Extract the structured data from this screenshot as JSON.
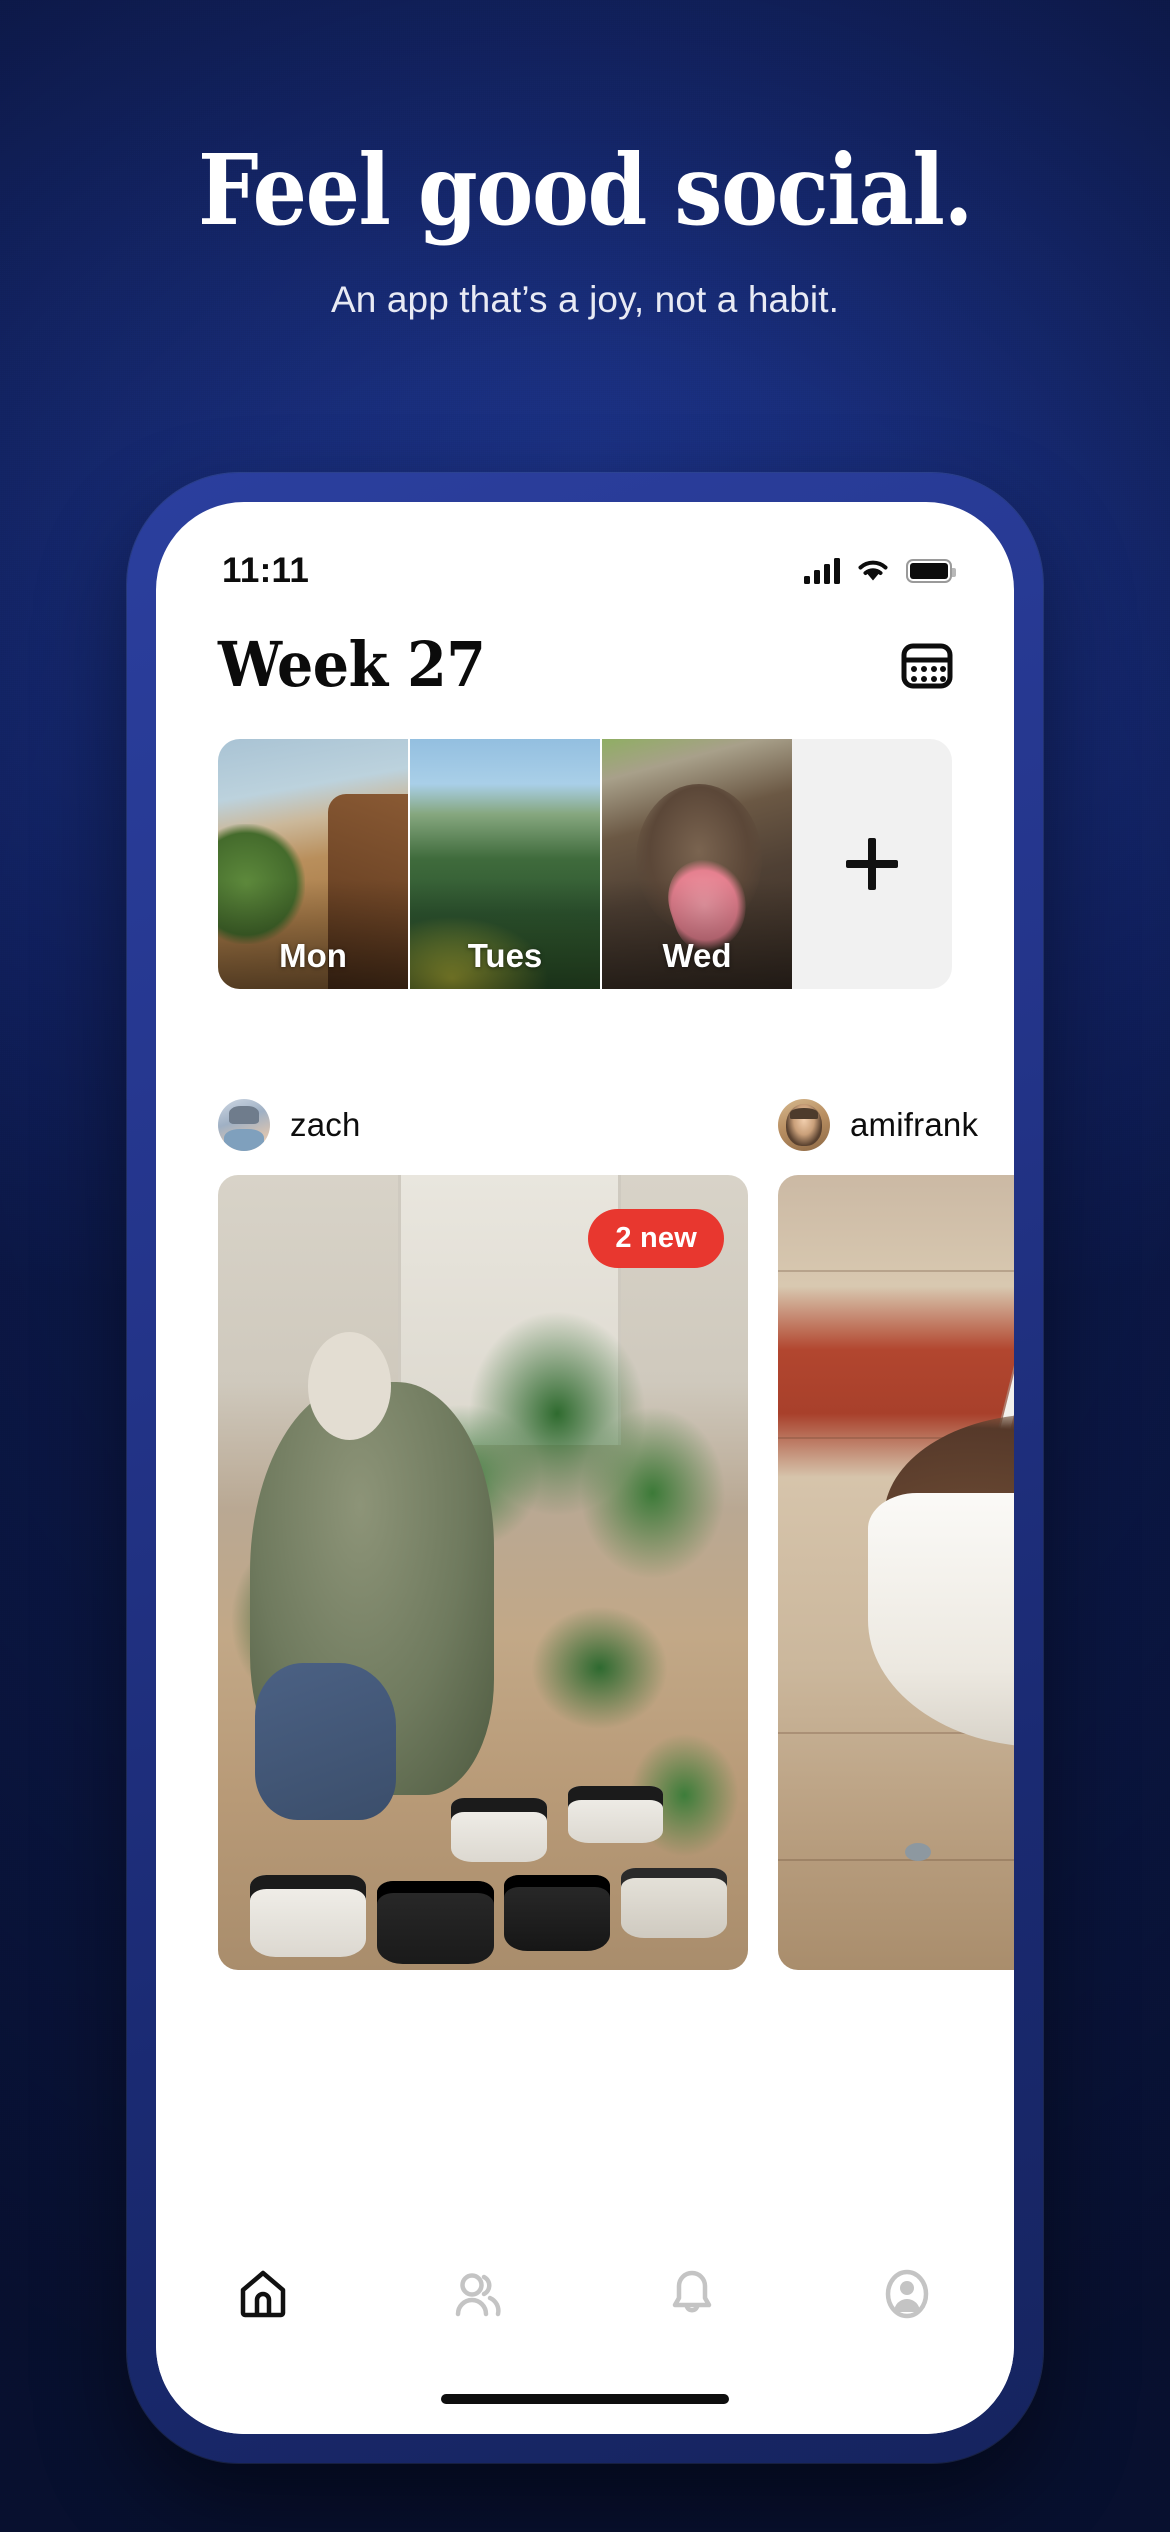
{
  "hero": {
    "headline": "Feel good social.",
    "subheadline": "An app that’s a joy, not a habit.",
    "background_color": "#15286f"
  },
  "phone": {
    "frame_color": "#24358b",
    "screen_background": "#ffffff"
  },
  "status_bar": {
    "time": "11:11",
    "icons": [
      "cellular-signal-icon",
      "wifi-icon",
      "battery-icon"
    ],
    "battery_full": true
  },
  "app_header": {
    "title": "Week 27",
    "calendar_button": "calendar-icon"
  },
  "day_strip": {
    "days": [
      {
        "label": "Mon",
        "photo": "window-desk-plant"
      },
      {
        "label": "Tues",
        "photo": "forest-hillside"
      },
      {
        "label": "Wed",
        "photo": "dog-licking-nose"
      }
    ],
    "add_button_label": "+",
    "add_button_background": "#f1f1f1"
  },
  "feed": {
    "posts": [
      {
        "username": "zach",
        "avatar": "zach-avatar",
        "photo": "person-potting-plants",
        "badge": "2 new",
        "badge_color": "#e8372f"
      },
      {
        "username": "amifrank",
        "avatar": "amifrank-avatar",
        "photo": "chocolate-ice-cream-bowl",
        "badge": null
      }
    ]
  },
  "tab_bar": {
    "tabs": [
      {
        "name": "home",
        "icon": "home-icon",
        "active": true
      },
      {
        "name": "friends",
        "icon": "people-icon",
        "active": false
      },
      {
        "name": "notifications",
        "icon": "bell-icon",
        "active": false
      },
      {
        "name": "profile",
        "icon": "person-circle-icon",
        "active": false
      }
    ],
    "active_color": "#111111",
    "inactive_color": "#c4c4c4"
  }
}
